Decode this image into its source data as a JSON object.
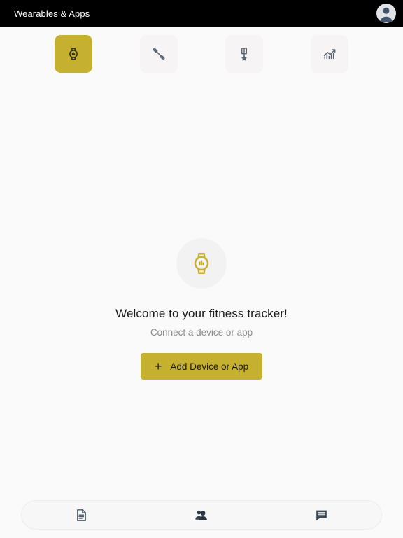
{
  "appbar": {
    "title": "Wearables & Apps",
    "avatar_icon": "person-avatar-icon"
  },
  "theme": {
    "accent": "#c6b02f",
    "appbar_bg": "#000000",
    "page_bg": "#fafafa",
    "tab_bg": "#f7f4f5",
    "icon_gray": "#5a6672"
  },
  "tabs": [
    {
      "id": "devices",
      "icon": "watch-icon",
      "label": "Devices",
      "active": true
    },
    {
      "id": "workouts",
      "icon": "dumbbell-icon",
      "label": "Workouts",
      "active": false
    },
    {
      "id": "awards",
      "icon": "medal-icon",
      "label": "Awards",
      "active": false
    },
    {
      "id": "stats",
      "icon": "chart-icon",
      "label": "Stats",
      "active": false
    }
  ],
  "empty_state": {
    "icon": "watch-icon",
    "title": "Welcome to your fitness tracker!",
    "subtitle": "Connect a device or app",
    "button_plus": "+",
    "button_label": "Add Device or App"
  },
  "bottom_nav": [
    {
      "id": "feed",
      "icon": "document-icon",
      "label": "Feed"
    },
    {
      "id": "friends",
      "icon": "people-icon",
      "label": "Friends"
    },
    {
      "id": "messages",
      "icon": "chat-icon",
      "label": "Messages"
    }
  ]
}
